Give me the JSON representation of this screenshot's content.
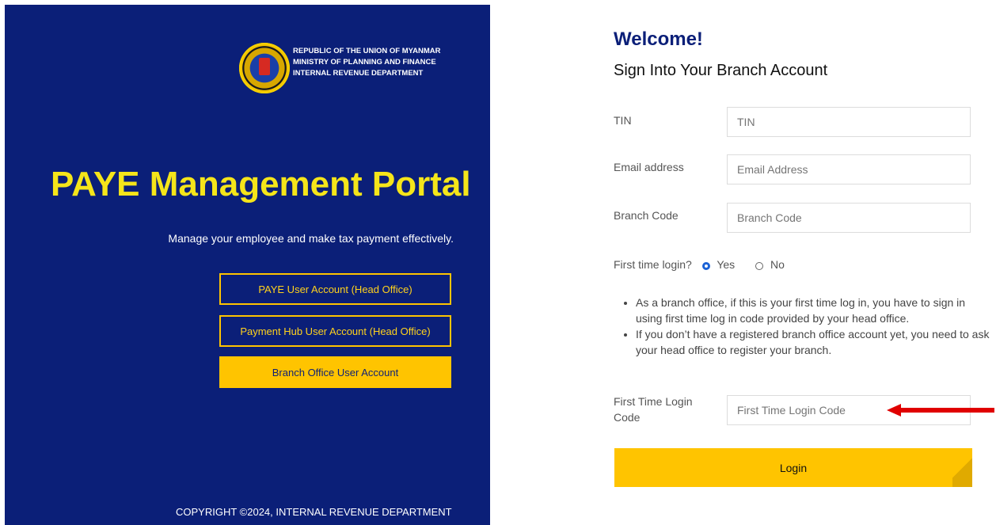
{
  "left": {
    "emblem_lines": [
      "REPUBLIC OF THE UNION OF MYANMAR",
      "MINISTRY OF PLANNING AND FINANCE",
      "INTERNAL REVENUE DEPARTMENT"
    ],
    "title": "PAYE Management Portal",
    "subtitle": "Manage your employee and make tax payment effectively.",
    "buttons": [
      "PAYE User Account (Head Office)",
      "Payment Hub User Account (Head Office)",
      "Branch Office User Account"
    ],
    "copyright": "COPYRIGHT ©2024, INTERNAL REVENUE DEPARTMENT"
  },
  "form": {
    "welcome": "Welcome!",
    "heading": "Sign Into Your Branch Account",
    "tin_label": "TIN",
    "tin_placeholder": "TIN",
    "email_label": "Email address",
    "email_placeholder": "Email Address",
    "branch_label": "Branch Code",
    "branch_placeholder": "Branch Code",
    "first_time_question": "First time login?",
    "yes": "Yes",
    "no": "No",
    "notes": [
      "As a branch office, if this is your first time log in, you have to sign in using first time log in code provided by your head office.",
      "If you don’t have a registered branch office account yet, you need to ask your head office to register your branch."
    ],
    "code_label": "First Time Login Code",
    "code_placeholder": "First Time Login Code",
    "login": "Login"
  },
  "colors": {
    "navy": "#0b1f78",
    "yellow": "#ffc400",
    "arrow": "#e00000"
  }
}
